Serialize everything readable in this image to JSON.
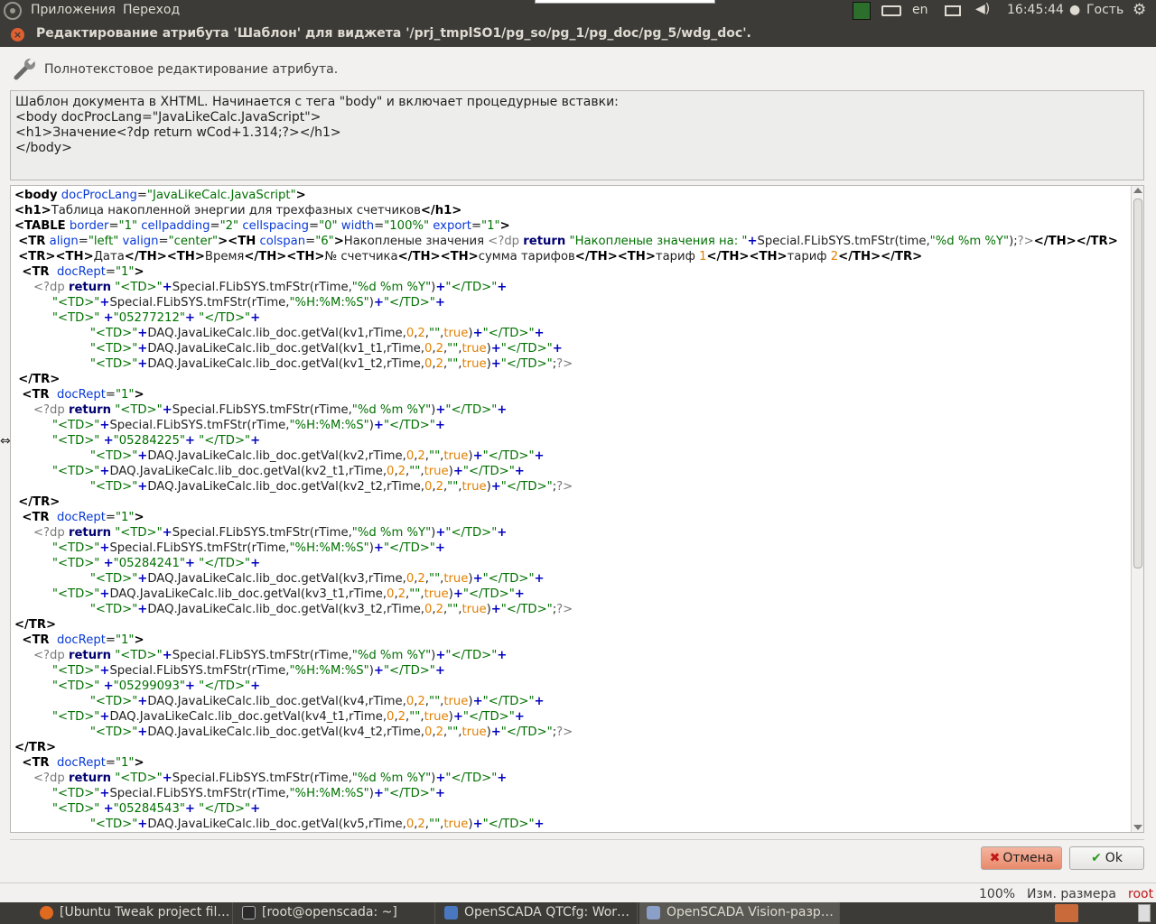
{
  "top_panel": {
    "apps_menu": "Приложения",
    "go_menu": "Переход",
    "keyboard_layout": "en",
    "clock": "16:45:44",
    "user": "Гость"
  },
  "dialog": {
    "title": "Редактирование атрибута 'Шаблон' для виджета '/prj_tmplSO1/pg_so/pg_1/pg_doc/pg_5/wdg_doc'.",
    "header_label": "Полнотекстовое редактирование атрибута.",
    "description": [
      "Шаблон документа в XHTML. Начинается с тега \"body\" и включает процедурные вставки:",
      "<body docProcLang=\"JavaLikeCalc.JavaScript\">",
      "<h1>Значение<?dp return wCod+1.314;?></h1>",
      "</body>"
    ],
    "cancel_label": "Отмена",
    "ok_label": "Ok"
  },
  "code_lines": [
    "<body docProcLang=\"JavaLikeCalc.JavaScript\">",
    "<h1>Таблица накопленной энергии для трехфазных счетчиков</h1>",
    "<TABLE border=\"1\" cellpadding=\"2\" cellspacing=\"0\" width=\"100%\" export=\"1\">",
    " <TR align=\"left\" valign=\"center\"><TH colspan=\"6\">Накопленые значения <?dp return \"Накопленые значения на: \"+Special.FLibSYS.tmFStr(time,\"%d %m %Y\");?></TH></TR>",
    " <TR><TH>Дата</TH><TH>Время</TH><TH>№ счетчика</TH><TH>сумма тарифов</TH><TH>тариф 1</TH><TH>тариф 2</TH></TR>",
    "  <TR  docRept=\"1\">",
    "     <?dp return \"<TD>\"+Special.FLibSYS.tmFStr(rTime,\"%d %m %Y\")+\"</TD>\"+",
    "          \"<TD>\"+Special.FLibSYS.tmFStr(rTime,\"%H:%M:%S\")+\"</TD>\"+",
    "          \"<TD>\" +\"05277212\"+ \"</TD>\"+",
    "                    \"<TD>\"+DAQ.JavaLikeCalc.lib_doc.getVal(kv1,rTime,0,2,\"\",true)+\"</TD>\"+",
    "                    \"<TD>\"+DAQ.JavaLikeCalc.lib_doc.getVal(kv1_t1,rTime,0,2,\"\",true)+\"</TD>\"+",
    "                    \"<TD>\"+DAQ.JavaLikeCalc.lib_doc.getVal(kv1_t2,rTime,0,2,\"\",true)+\"</TD>\";?>",
    " </TR>",
    "  <TR  docRept=\"1\">",
    "     <?dp return \"<TD>\"+Special.FLibSYS.tmFStr(rTime,\"%d %m %Y\")+\"</TD>\"+",
    "          \"<TD>\"+Special.FLibSYS.tmFStr(rTime,\"%H:%M:%S\")+\"</TD>\"+",
    "          \"<TD>\" +\"05284225\"+ \"</TD>\"+",
    "                    \"<TD>\"+DAQ.JavaLikeCalc.lib_doc.getVal(kv2,rTime,0,2,\"\",true)+\"</TD>\"+",
    "          \"<TD>\"+DAQ.JavaLikeCalc.lib_doc.getVal(kv2_t1,rTime,0,2,\"\",true)+\"</TD>\"+",
    "                    \"<TD>\"+DAQ.JavaLikeCalc.lib_doc.getVal(kv2_t2,rTime,0,2,\"\",true)+\"</TD>\";?>",
    " </TR>",
    "  <TR  docRept=\"1\">",
    "     <?dp return \"<TD>\"+Special.FLibSYS.tmFStr(rTime,\"%d %m %Y\")+\"</TD>\"+",
    "          \"<TD>\"+Special.FLibSYS.tmFStr(rTime,\"%H:%M:%S\")+\"</TD>\"+",
    "          \"<TD>\" +\"05284241\"+ \"</TD>\"+",
    "                    \"<TD>\"+DAQ.JavaLikeCalc.lib_doc.getVal(kv3,rTime,0,2,\"\",true)+\"</TD>\"+",
    "          \"<TD>\"+DAQ.JavaLikeCalc.lib_doc.getVal(kv3_t1,rTime,0,2,\"\",true)+\"</TD>\"+",
    "                    \"<TD>\"+DAQ.JavaLikeCalc.lib_doc.getVal(kv3_t2,rTime,0,2,\"\",true)+\"</TD>\";?>",
    "</TR>",
    "  <TR  docRept=\"1\">",
    "     <?dp return \"<TD>\"+Special.FLibSYS.tmFStr(rTime,\"%d %m %Y\")+\"</TD>\"+",
    "          \"<TD>\"+Special.FLibSYS.tmFStr(rTime,\"%H:%M:%S\")+\"</TD>\"+",
    "          \"<TD>\" +\"05299093\"+ \"</TD>\"+",
    "                    \"<TD>\"+DAQ.JavaLikeCalc.lib_doc.getVal(kv4,rTime,0,2,\"\",true)+\"</TD>\"+",
    "          \"<TD>\"+DAQ.JavaLikeCalc.lib_doc.getVal(kv4_t1,rTime,0,2,\"\",true)+\"</TD>\"+",
    "                    \"<TD>\"+DAQ.JavaLikeCalc.lib_doc.getVal(kv4_t2,rTime,0,2,\"\",true)+\"</TD>\";?>",
    "</TR>",
    "  <TR  docRept=\"1\">",
    "     <?dp return \"<TD>\"+Special.FLibSYS.tmFStr(rTime,\"%d %m %Y\")+\"</TD>\"+",
    "          \"<TD>\"+Special.FLibSYS.tmFStr(rTime,\"%H:%M:%S\")+\"</TD>\"+",
    "          \"<TD>\" +\"05284543\"+ \"</TD>\"+",
    "                    \"<TD>\"+DAQ.JavaLikeCalc.lib_doc.getVal(kv5,rTime,0,2,\"\",true)+\"</TD>\"+"
  ],
  "status_bar": {
    "zoom": "100%",
    "mode": "Изм. размера",
    "user": "root"
  },
  "taskbar": [
    {
      "label": "[Ubuntu Tweak project fil…",
      "icon": "firefox-icon"
    },
    {
      "label": "[root@openscada: ~]",
      "icon": "terminal-icon"
    },
    {
      "label": "OpenSCADA QTCfg: Wor…",
      "icon": "openscada-cfg-icon"
    },
    {
      "label": "OpenSCADA Vision-разр…",
      "icon": "openscada-vision-icon"
    }
  ],
  "colors": {
    "tag": "#000000",
    "attr": "#0a3bd6",
    "string": "#007000",
    "number": "#e08000",
    "operator": "#0000c0"
  }
}
